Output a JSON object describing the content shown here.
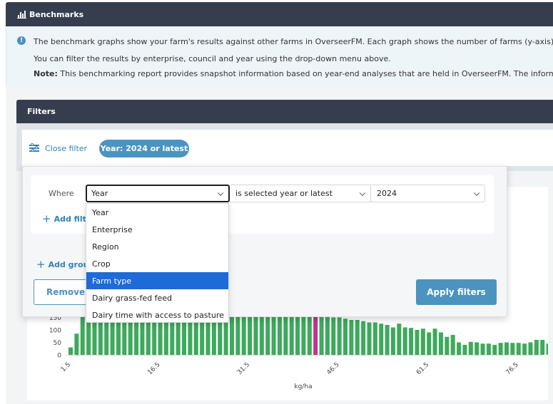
{
  "header": {
    "title": "Benchmarks",
    "icon": "bar-chart-icon"
  },
  "info": {
    "icon": "info-icon",
    "line1": "The benchmark graphs show your farm's results against other farms in OverseerFM. Each graph shows the number of farms (y-axis) that have th",
    "line2": "You can filter the results by enterprise, council and year using the drop-down menu above.",
    "note_label": "Note:",
    "note_text": " This benchmarking report provides snapshot information based on year-end analyses that are held in OverseerFM. The information in this"
  },
  "filters": {
    "title": "Filters",
    "close_label": "Close filter",
    "active_pill": "Year: 2024 or latest",
    "where_label": "Where",
    "field_select": "Year",
    "operator_select": "is selected year or latest",
    "value_select": "2024",
    "add_filter_label": "Add filter",
    "add_group_label": "Add group",
    "remove_label": "Remove filters",
    "apply_label": "Apply filters",
    "dropdown_options": [
      "Year",
      "Enterprise",
      "Region",
      "Crop",
      "Farm type",
      "Dairy grass-fed feed",
      "Dairy time with access to pasture"
    ],
    "highlighted_option": "Farm type"
  },
  "chart_data": {
    "type": "bar",
    "xlabel": "kg/ha",
    "ylabel": "",
    "y_ticks": [
      "0",
      "50",
      "100",
      "150"
    ],
    "x_ticks": [
      "1.5",
      "16.5",
      "31.5",
      "46.5",
      "61.5",
      "76.5"
    ],
    "x_start": 1.5,
    "x_step": 1,
    "highlight_index": 41,
    "colors": {
      "bar": "#3daa5c",
      "highlight": "#c2338f"
    },
    "values": [
      30,
      85,
      160,
      175,
      180,
      180,
      180,
      180,
      180,
      180,
      180,
      180,
      180,
      180,
      180,
      180,
      180,
      180,
      180,
      180,
      180,
      180,
      180,
      180,
      180,
      180,
      180,
      180,
      180,
      180,
      180,
      180,
      180,
      180,
      180,
      180,
      180,
      180,
      180,
      180,
      180,
      180,
      180,
      160,
      150,
      150,
      145,
      140,
      140,
      135,
      130,
      130,
      125,
      120,
      110,
      125,
      110,
      108,
      100,
      105,
      90,
      105,
      90,
      72,
      80,
      50,
      40,
      52,
      50,
      45,
      45,
      40,
      48,
      50,
      48,
      48,
      45,
      50,
      60,
      60,
      45,
      40,
      30,
      28,
      25,
      20
    ]
  }
}
